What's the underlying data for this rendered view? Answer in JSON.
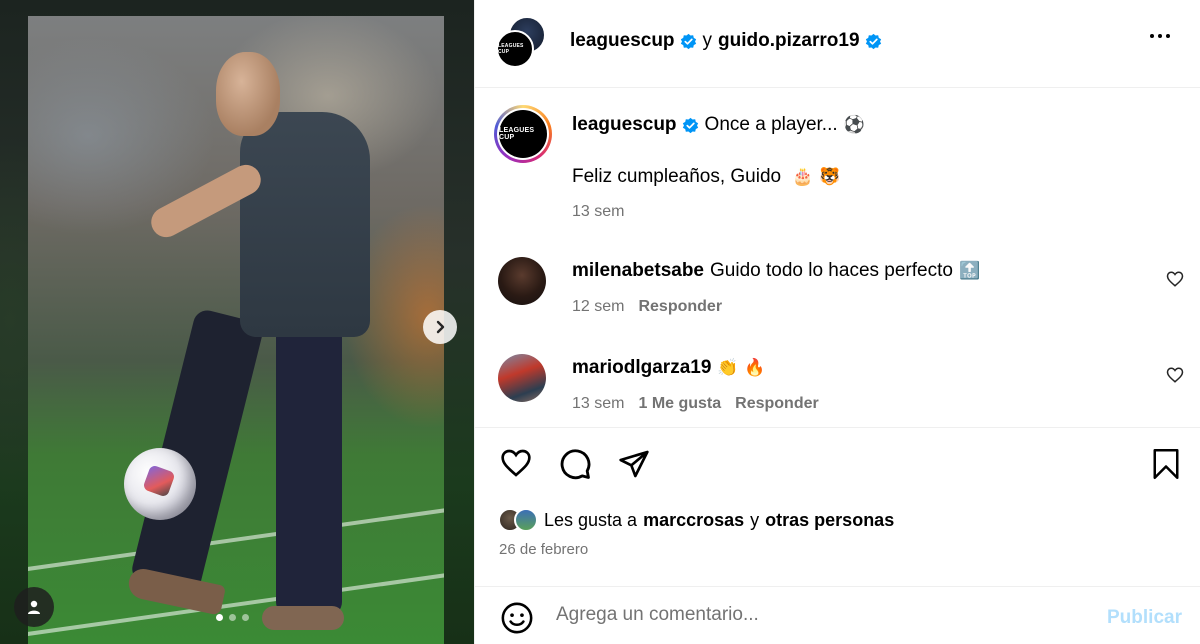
{
  "header": {
    "account_1": "leaguescup",
    "conjunction": "y",
    "account_2": "guido.pizarro19",
    "logo_text": "LEAGUES CUP"
  },
  "caption": {
    "username": "leaguescup",
    "text": "Once a player...",
    "text_emoji": "⚽",
    "line2": "Feliz cumpleaños, Guido",
    "line2_emojis": "🎂 🐯",
    "time": "13 sem"
  },
  "comments": [
    {
      "username": "milenabetsabe",
      "text": "Guido todo lo haces perfecto",
      "emoji": "🔝",
      "time": "12 sem",
      "likes": "",
      "reply_label": "Responder"
    },
    {
      "username": "mariodlgarza19",
      "text": "",
      "emoji": "👏 🔥",
      "time": "13 sem",
      "likes": "1 Me gusta",
      "reply_label": "Responder"
    }
  ],
  "likes": {
    "prefix": "Les gusta a",
    "user": "marccrosas",
    "connector": "y",
    "others": "otras personas"
  },
  "date": "26 de febrero",
  "comment_box": {
    "placeholder": "Agrega un comentario...",
    "publish_label": "Publicar"
  },
  "carousel": {
    "total_slides": 3,
    "active_slide": 1
  },
  "colors": {
    "verified": "#0095f6",
    "muted_text": "#737373",
    "publish_disabled": "#b2dffc"
  }
}
